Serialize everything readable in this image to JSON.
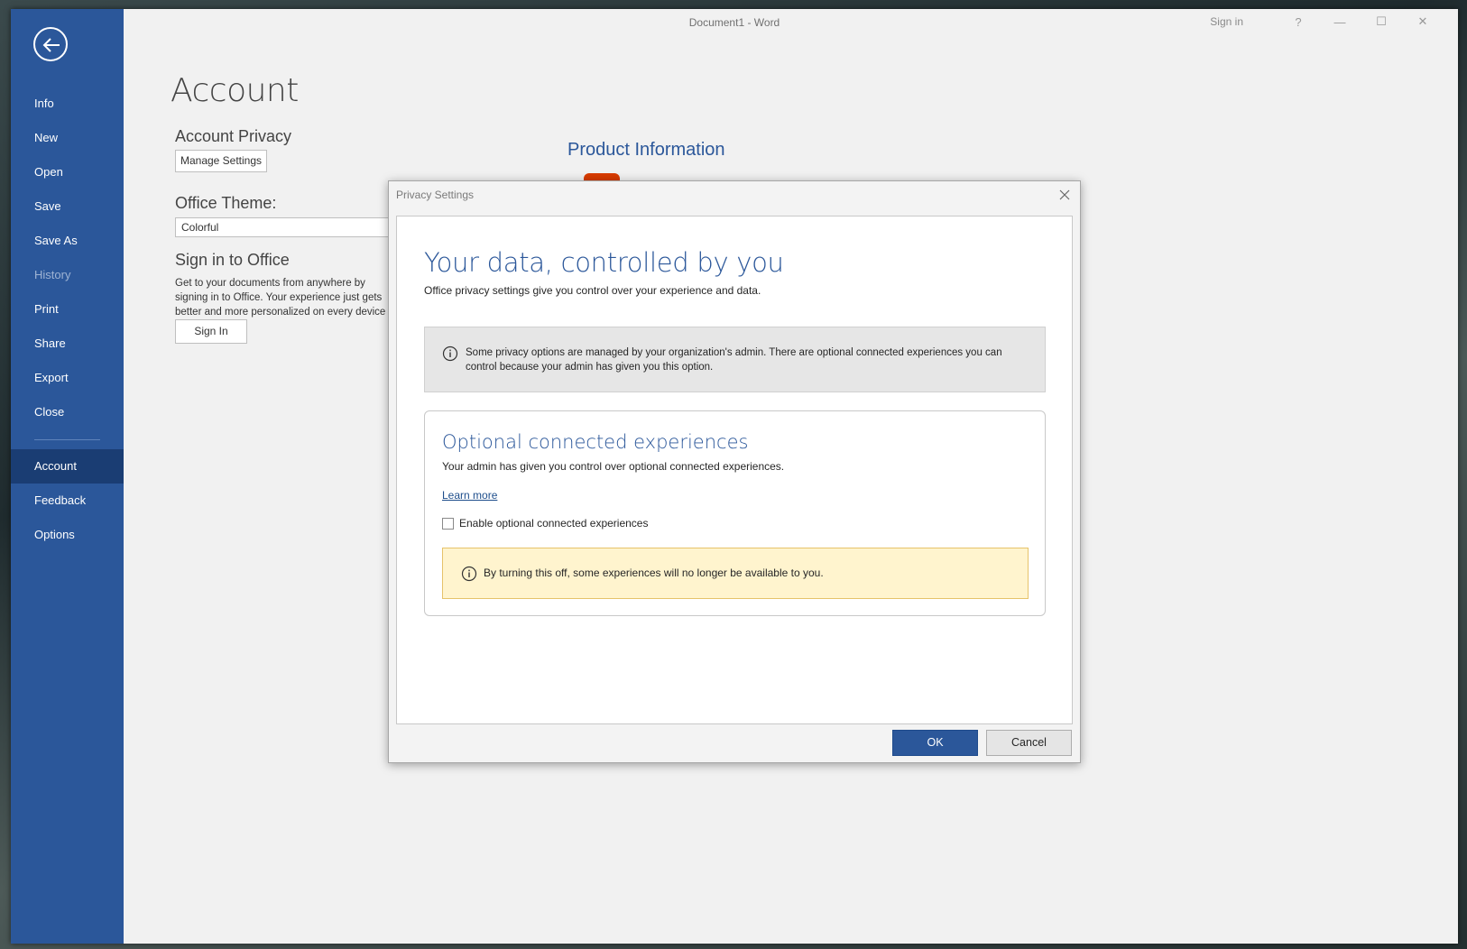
{
  "window": {
    "title": "Document1  -  Word",
    "sign_in": "Sign in",
    "help": "?",
    "minimize": "—",
    "maximize": "☐",
    "close": "✕"
  },
  "sidebar": {
    "items": [
      {
        "label": "Info"
      },
      {
        "label": "New"
      },
      {
        "label": "Open"
      },
      {
        "label": "Save"
      },
      {
        "label": "Save As"
      },
      {
        "label": "History"
      },
      {
        "label": "Print"
      },
      {
        "label": "Share"
      },
      {
        "label": "Export"
      },
      {
        "label": "Close"
      },
      {
        "label": "Account"
      },
      {
        "label": "Feedback"
      },
      {
        "label": "Options"
      }
    ]
  },
  "account": {
    "title": "Account",
    "privacy_label": "Account Privacy",
    "manage_settings": "Manage Settings",
    "theme_label": "Office Theme:",
    "theme_value": "Colorful",
    "signin_label": "Sign in to Office",
    "signin_desc": "Get to your documents from anywhere by signing in to Office. Your experience just gets better and more personalized on every device you use.",
    "signin_button": "Sign In",
    "product_info": "Product Information"
  },
  "dialog": {
    "title": "Privacy Settings",
    "hero_title": "Your data, controlled by you",
    "hero_sub": "Office privacy settings give you control over your experience and data.",
    "admin_notice": "Some privacy options are managed by your organization's admin. There are optional connected experiences you can control because your admin has given you this option.",
    "card_title": "Optional connected experiences",
    "card_sub": "Your admin has given you control over optional connected experiences.",
    "learn_more": "Learn more",
    "checkbox_label": "Enable optional connected experiences",
    "warning": "By turning this off, some experiences will no longer be available to you.",
    "ok": "OK",
    "cancel": "Cancel"
  }
}
